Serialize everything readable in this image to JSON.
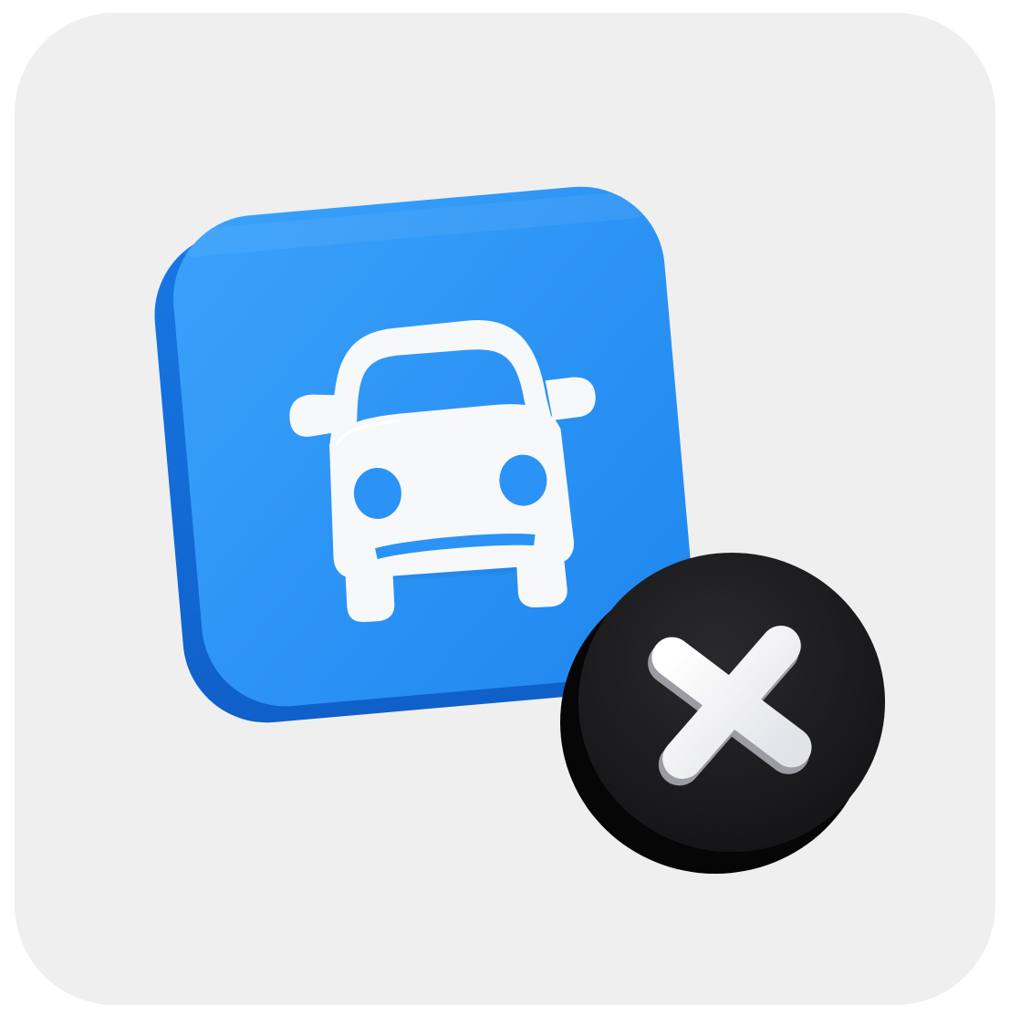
{
  "colors": {
    "card_background": "#efeff0",
    "tile_top": "#2b94f6",
    "tile_side": "#1572dc",
    "car_glyph": "#f7f8fa",
    "badge_top": "#1c1c1e",
    "badge_side": "#050506",
    "cross_glyph": "#f4f4f6"
  },
  "icons": {
    "tile": "car-icon",
    "badge": "close-icon"
  }
}
